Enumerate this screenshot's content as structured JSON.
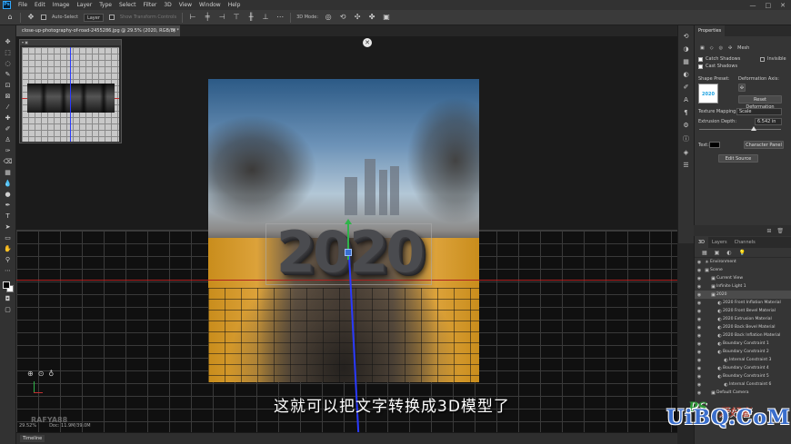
{
  "app": {
    "logo": "Ps"
  },
  "menu": [
    "File",
    "Edit",
    "Image",
    "Layer",
    "Type",
    "Select",
    "Filter",
    "3D",
    "View",
    "Window",
    "Help"
  ],
  "window_controls": {
    "minimize": "—",
    "maximize": "□",
    "close": "✕"
  },
  "options_bar": {
    "auto_select_label": "Auto-Select",
    "layer_select": "Layer",
    "show_transform_label": "Show Transform Controls",
    "mode_3d_label": "3D Mode:"
  },
  "document_tab": {
    "title": "close-up-photography-of-road-2455286.jpg @ 29.5% (2020, RGB/8) *",
    "close": "×"
  },
  "canvas": {
    "text_3d": "2020"
  },
  "caption": "这就可以把文字转换成3D模型了",
  "watermark_left": "RAFYA88",
  "status_bar": {
    "zoom": "29.52%",
    "doc": "Doc: 11.9M/39.0M"
  },
  "timeline_label": "Timeline",
  "properties": {
    "tab": "Properties",
    "mesh_label": "Mesh",
    "catch_shadows": "Catch Shadows",
    "cast_shadows": "Cast Shadows",
    "invisible": "Invisible",
    "shape_preset": "Shape Preset:",
    "deformation_axis": "Deformation Axis:",
    "reset_deformation": "Reset Deformation",
    "texture_mapping": "Texture Mapping:",
    "texture_value": "Scale",
    "extrusion_depth": "Extrusion Depth:",
    "extrusion_value": "6.542 in",
    "text_label": "Text:",
    "character_panel": "Character Panel",
    "edit_source": "Edit Source",
    "preview_text": "2020"
  },
  "panel_3d": {
    "tabs": [
      "3D",
      "Layers",
      "Channels"
    ],
    "items": [
      {
        "label": "Environment",
        "indent": 0
      },
      {
        "label": "Scene",
        "indent": 0
      },
      {
        "label": "Current View",
        "indent": 1
      },
      {
        "label": "Infinite Light 1",
        "indent": 1
      },
      {
        "label": "2020",
        "indent": 1,
        "selected": true
      },
      {
        "label": "2020 Front Inflation Material",
        "indent": 2
      },
      {
        "label": "2020 Front Bevel Material",
        "indent": 2
      },
      {
        "label": "2020 Extrusion Material",
        "indent": 2
      },
      {
        "label": "2020 Back Bevel Material",
        "indent": 2
      },
      {
        "label": "2020 Back Inflation Material",
        "indent": 2
      },
      {
        "label": "Boundary Constraint 1",
        "indent": 2
      },
      {
        "label": "Boundary Constraint 2",
        "indent": 2
      },
      {
        "label": "Internal Constraint 3",
        "indent": 3
      },
      {
        "label": "Boundary Constraint 4",
        "indent": 2
      },
      {
        "label": "Boundary Constraint 5",
        "indent": 2
      },
      {
        "label": "Internal Constraint 6",
        "indent": 3
      },
      {
        "label": "Default Camera",
        "indent": 1
      }
    ]
  },
  "brand": {
    "main": "UiBQ.CoM",
    "ps": "PS",
    "cn": "爱好者"
  },
  "colors": {
    "accent_blue": "#2a3aff",
    "gizmo_green": "#2fb34a",
    "guide_red": "#b02020"
  }
}
